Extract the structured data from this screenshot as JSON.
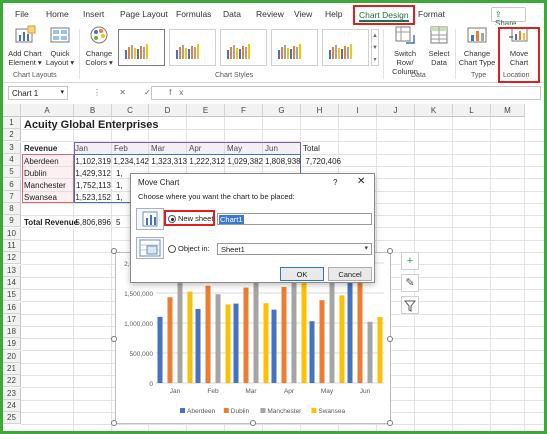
{
  "tabs": [
    "File",
    "Home",
    "Insert",
    "Page Layout",
    "Formulas",
    "Data",
    "Review",
    "View",
    "Help",
    "Chart Design",
    "Format"
  ],
  "active_tab": "Chart Design",
  "share_label": "Share",
  "ribbon": {
    "add_chart_element": [
      "Add Chart",
      "Element ▾"
    ],
    "quick_layout": [
      "Quick",
      "Layout ▾"
    ],
    "change_colors": [
      "Change",
      "Colors ▾"
    ],
    "switch_row_column": [
      "Switch Row/",
      "Column"
    ],
    "select_data": [
      "Select",
      "Data"
    ],
    "change_chart_type": [
      "Change",
      "Chart Type"
    ],
    "move_chart": [
      "Move",
      "Chart"
    ],
    "groups": {
      "chart_layouts": "Chart Layouts",
      "chart_styles": "Chart Styles",
      "data": "Data",
      "type": "Type",
      "location": "Location"
    }
  },
  "formula_bar": {
    "name_box": "Chart 1",
    "name_box_chevron": "▾",
    "fx_controls": "⋮ ✕ ✓ fx"
  },
  "columns": [
    "A",
    "B",
    "C",
    "D",
    "E",
    "F",
    "G",
    "H",
    "I",
    "J",
    "K",
    "L",
    "M"
  ],
  "rows": [
    "1",
    "2",
    "3",
    "4",
    "5",
    "6",
    "7",
    "8",
    "9",
    "10",
    "11",
    "12",
    "13",
    "14",
    "15",
    "16",
    "17",
    "18",
    "19",
    "20",
    "21",
    "22",
    "23",
    "24",
    "25"
  ],
  "sheet": {
    "title": "Acuity Global Enterprises",
    "header": [
      "Revenue",
      "Jan",
      "Feb",
      "Mar",
      "Apr",
      "May",
      "Jun",
      "Total"
    ],
    "data_rows": [
      [
        "Aberdeen",
        "1,102,319",
        "1,234,142",
        "1,323,313",
        "1,222,312",
        "1,029,382",
        "1,808,938",
        "7,720,406"
      ],
      [
        "Dublin",
        "1,429,312",
        "1,"
      ],
      [
        "Manchester",
        "1,752,113",
        "1,"
      ],
      [
        "Swansea",
        "1,523,152",
        "1,"
      ]
    ],
    "total_row": [
      "Total Revenue",
      "5,806,896",
      "5"
    ]
  },
  "dialog": {
    "title": "Move Chart",
    "help": "?",
    "close": "✕",
    "prompt": "Choose where you want the chart to be placed:",
    "new_sheet_label": "New sheet:",
    "new_sheet_value": "Chart1",
    "object_in_label": "Object in:",
    "object_in_value": "Sheet1",
    "ok": "OK",
    "cancel": "Cancel"
  },
  "chart_data": {
    "type": "bar",
    "categories": [
      "Jan",
      "Feb",
      "Mar",
      "Apr",
      "May",
      "Jun"
    ],
    "series": [
      {
        "name": "Aberdeen",
        "color": "#4472c4",
        "values": [
          1102319,
          1234142,
          1323313,
          1222312,
          1029382,
          1808938
        ]
      },
      {
        "name": "Dublin",
        "color": "#ed7d31",
        "values": [
          1429312,
          1620000,
          1590000,
          1600000,
          1380000,
          1700000
        ]
      },
      {
        "name": "Manchester",
        "color": "#a5a5a5",
        "values": [
          1752113,
          1480000,
          1850000,
          1980000,
          1850000,
          1020000
        ]
      },
      {
        "name": "Swansea",
        "color": "#ffc000",
        "values": [
          1523152,
          1310000,
          1330000,
          1940000,
          1460000,
          1100000
        ]
      }
    ],
    "yticks": [
      "0",
      "500,000",
      "1,000,000",
      "1,500,000",
      "2,000,000"
    ],
    "ylim": [
      0,
      2000000
    ],
    "legend_position": "bottom",
    "grid": true
  }
}
